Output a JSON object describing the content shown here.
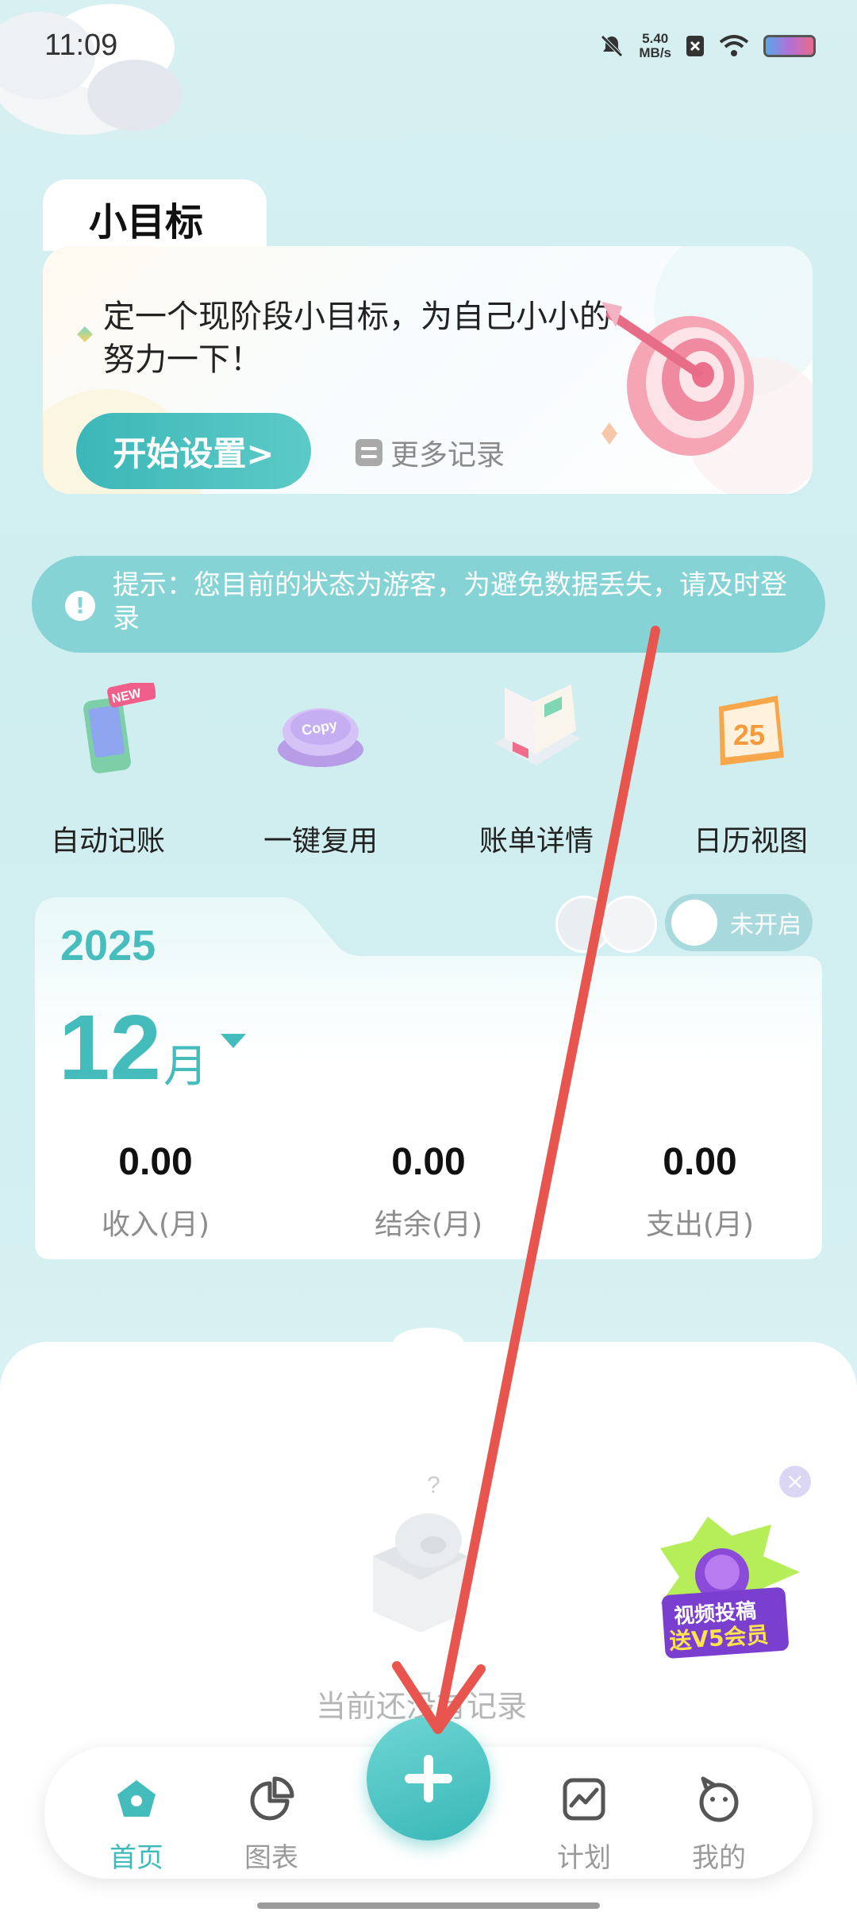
{
  "status_bar": {
    "time": "11:09",
    "speed_value": "5.40",
    "speed_unit": "MB/s"
  },
  "goal": {
    "tab_title": "小目标",
    "description": "定一个现阶段小目标，为自己小小的努力一下！",
    "start_button": "开始设置>",
    "more_records": "更多记录"
  },
  "tip": {
    "text": "提示：您目前的状态为游客，为避免数据丢失，请及时登录"
  },
  "quick_actions": [
    {
      "label": "自动记账",
      "icon": "phone-icon",
      "badge": "NEW"
    },
    {
      "label": "一键复用",
      "icon": "copy-button-icon",
      "button_text": "Copy"
    },
    {
      "label": "账单详情",
      "icon": "ledger-book-icon"
    },
    {
      "label": "日历视图",
      "icon": "calendar-icon",
      "day": "25"
    }
  ],
  "month_card": {
    "year": "2025",
    "month": "12",
    "month_unit": "月",
    "toggle_label": "未开启",
    "stats": [
      {
        "value": "0.00",
        "label": "收入(月)"
      },
      {
        "value": "0.00",
        "label": "结余(月)"
      },
      {
        "value": "0.00",
        "label": "支出(月)"
      }
    ]
  },
  "empty_state": {
    "text": "当前还没有记录"
  },
  "promo": {
    "line1": "视频投稿",
    "line2": "送V5会员",
    "close": "×"
  },
  "nav": [
    {
      "label": "首页",
      "icon": "home-icon",
      "active": true
    },
    {
      "label": "图表",
      "icon": "pie-chart-icon",
      "active": false
    },
    {
      "label": "计划",
      "icon": "trend-chart-icon",
      "active": false
    },
    {
      "label": "我的",
      "icon": "profile-icon",
      "active": false
    }
  ],
  "colors": {
    "accent": "#45bcbc",
    "tip_bg": "#86d3d6",
    "overlay_arrow": "#e8554e"
  }
}
